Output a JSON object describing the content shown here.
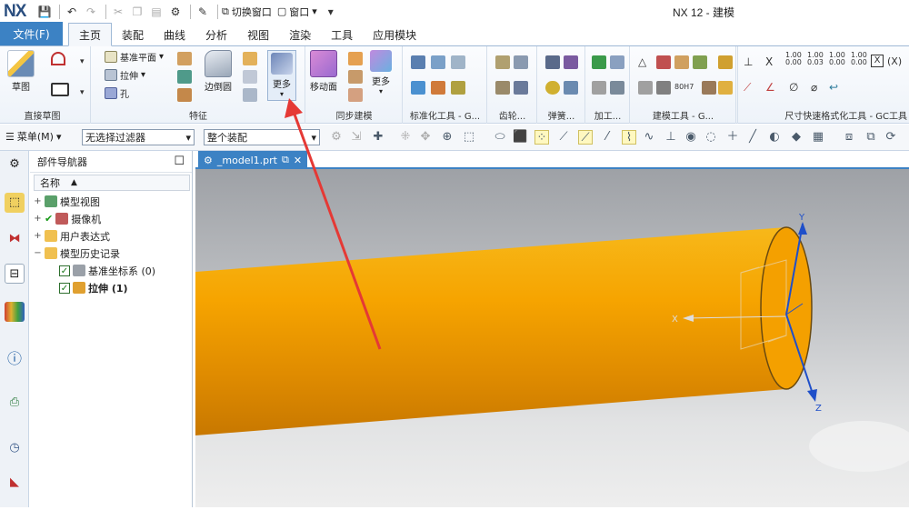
{
  "app": {
    "logo": "NX",
    "window_title": "NX 12 - 建模"
  },
  "quick_access": {
    "switch_window": "切换窗口",
    "window_menu": "窗口"
  },
  "tabs": [
    "文件(F)",
    "主页",
    "装配",
    "曲线",
    "分析",
    "视图",
    "渲染",
    "工具",
    "应用模块"
  ],
  "active_tab": "主页",
  "ribbon": {
    "sketch_label": "草图",
    "sketch_group": "直接草图",
    "datum_plane": "基准平面",
    "extrude": "拉伸",
    "hole": "孔",
    "edge_blend": "边倒圆",
    "more": "更多",
    "feature_group": "特征",
    "move_face": "移动面",
    "more2": "更多",
    "sync_group": "同步建模",
    "std_tools_group": "标准化工具 - G...",
    "gear_group": "齿轮...",
    "spring_group": "弹簧...",
    "machining_group": "加工...",
    "model_tools_group": "建模工具 - G...",
    "dim_group": "尺寸快速格式化工具 - GC工具",
    "dim_values": [
      "1.00",
      "1.00",
      "1.00",
      "1.00"
    ],
    "dim_values_sub": [
      "0.00",
      "0.03",
      "0.00",
      "0.00"
    ],
    "hole_text": "80H7",
    "x_symbol": "X",
    "bracket_x": "(X)"
  },
  "filter_bar": {
    "menu": "菜单(M)",
    "filter": "无选择过滤器",
    "scope": "整个装配"
  },
  "navigator": {
    "title": "部件导航器",
    "col_name": "名称",
    "items": [
      {
        "label": "模型视图",
        "expand": "+"
      },
      {
        "label": "摄像机",
        "expand": "+"
      },
      {
        "label": "用户表达式",
        "expand": "+"
      },
      {
        "label": "模型历史记录",
        "expand": "−"
      },
      {
        "label": "基准坐标系 (0)",
        "expand": ""
      },
      {
        "label": "拉伸 (1)",
        "expand": ""
      }
    ]
  },
  "document": {
    "tab": "_model1.prt"
  },
  "viewport": {
    "axes": {
      "x": "X",
      "y": "Y",
      "z": "Z"
    },
    "colors": {
      "cylinder": "#f6a500",
      "arrow": "#e53935",
      "axis": "#1f4fc9"
    }
  }
}
